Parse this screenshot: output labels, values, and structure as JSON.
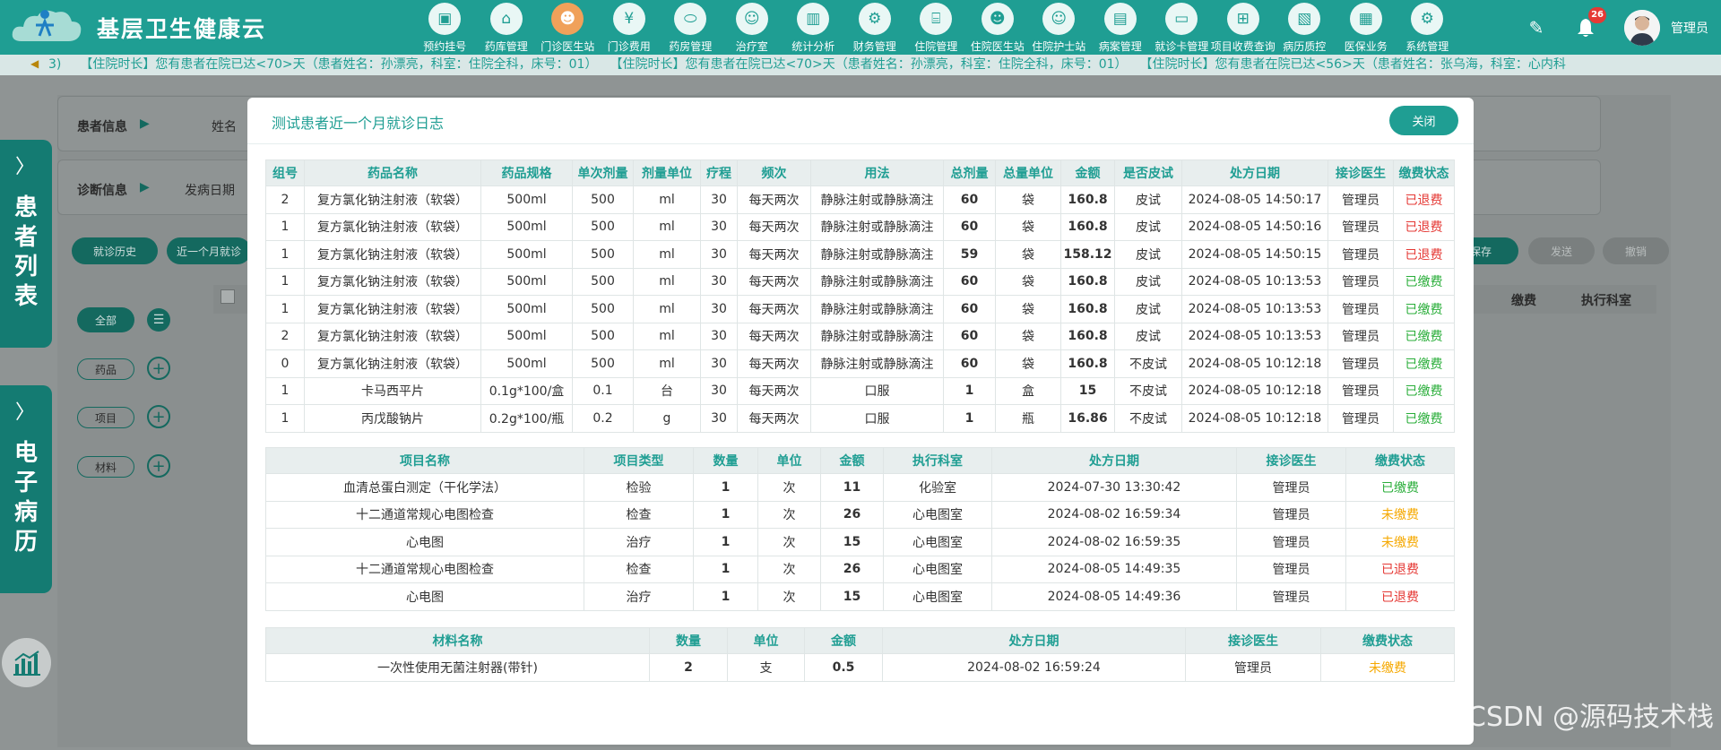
{
  "app": {
    "brand": "基层卫生健康云",
    "username": "管理员",
    "notification_count": "26"
  },
  "nav": [
    {
      "label": "预约挂号",
      "icon": "calendar-icon",
      "glyph": "▣"
    },
    {
      "label": "药库管理",
      "icon": "warehouse-icon",
      "glyph": "⌂"
    },
    {
      "label": "门诊医生站",
      "icon": "doctor-icon",
      "glyph": "☻",
      "active": true
    },
    {
      "label": "门诊费用",
      "icon": "yen-icon",
      "glyph": "¥"
    },
    {
      "label": "药房管理",
      "icon": "pill-icon",
      "glyph": "⬭"
    },
    {
      "label": "治疗室",
      "icon": "nurse-icon",
      "glyph": "☺"
    },
    {
      "label": "统计分析",
      "icon": "chart-icon",
      "glyph": "▥"
    },
    {
      "label": "财务管理",
      "icon": "finance-gear-icon",
      "glyph": "⚙"
    },
    {
      "label": "住院管理",
      "icon": "bed-icon",
      "glyph": "⌸"
    },
    {
      "label": "住院医生站",
      "icon": "inpatient-doctor-icon",
      "glyph": "☻"
    },
    {
      "label": "住院护士站",
      "icon": "inpatient-nurse-icon",
      "glyph": "☺"
    },
    {
      "label": "病案管理",
      "icon": "case-file-icon",
      "glyph": "▤"
    },
    {
      "label": "就诊卡管理",
      "icon": "card-icon",
      "glyph": "▭"
    },
    {
      "label": "项目收费查询",
      "icon": "fee-query-icon",
      "glyph": "⊞"
    },
    {
      "label": "病历质控",
      "icon": "quality-icon",
      "glyph": "▧"
    },
    {
      "label": "医保业务",
      "icon": "insurance-icon",
      "glyph": "▦"
    },
    {
      "label": "系统管理",
      "icon": "system-gear-icon",
      "glyph": "⚙"
    }
  ],
  "marquee": "3)　　【住院时长】您有患者在院已达<70>天（患者姓名：孙漂亮，科室：住院全科，床号：01）　　【住院时长】您有患者在院已达<70>天（患者姓名：孙漂亮，科室：住院全科，床号：01）　　【住院时长】您有患者在院已达<56>天（患者姓名：张乌海，科室：心内科",
  "background": {
    "left_panel_1": "患者列表",
    "left_panel_2": "电子病历",
    "patient_info_label": "患者信息",
    "patient_name_label": "姓名",
    "diagnosis_label": "诊断信息",
    "onset_date_label": "发病日期",
    "history_btn": "就诊历史",
    "recent_btn": "近一个月就诊",
    "save_btn": "保存",
    "send_btn": "发送",
    "revoke_btn": "撤销",
    "col_fee": "缴费",
    "col_dept": "执行科室",
    "filter_all": "全部",
    "filter_drug": "药品",
    "filter_item": "项目",
    "filter_material": "材料"
  },
  "modal": {
    "title": "测试患者近一个月就诊日志",
    "close_label": "关闭",
    "drug_headers": [
      "组号",
      "药品名称",
      "药品规格",
      "单次剂量",
      "剂量单位",
      "疗程",
      "频次",
      "用法",
      "总剂量",
      "总量单位",
      "金额",
      "是否皮试",
      "处方日期",
      "接诊医生",
      "缴费状态"
    ],
    "drugs": [
      [
        "2",
        "复方氯化钠注射液（软袋）",
        "500ml",
        "500",
        "ml",
        "30",
        "每天两次",
        "静脉注射或静脉滴注",
        "60",
        "袋",
        "160.8",
        "皮试",
        "2024-08-05 14:50:17",
        "管理员",
        "已退费"
      ],
      [
        "1",
        "复方氯化钠注射液（软袋）",
        "500ml",
        "500",
        "ml",
        "30",
        "每天两次",
        "静脉注射或静脉滴注",
        "60",
        "袋",
        "160.8",
        "皮试",
        "2024-08-05 14:50:16",
        "管理员",
        "已退费"
      ],
      [
        "1",
        "复方氯化钠注射液（软袋）",
        "500ml",
        "500",
        "ml",
        "30",
        "每天两次",
        "静脉注射或静脉滴注",
        "59",
        "袋",
        "158.12",
        "皮试",
        "2024-08-05 14:50:15",
        "管理员",
        "已退费"
      ],
      [
        "1",
        "复方氯化钠注射液（软袋）",
        "500ml",
        "500",
        "ml",
        "30",
        "每天两次",
        "静脉注射或静脉滴注",
        "60",
        "袋",
        "160.8",
        "皮试",
        "2024-08-05 10:13:53",
        "管理员",
        "已缴费"
      ],
      [
        "1",
        "复方氯化钠注射液（软袋）",
        "500ml",
        "500",
        "ml",
        "30",
        "每天两次",
        "静脉注射或静脉滴注",
        "60",
        "袋",
        "160.8",
        "皮试",
        "2024-08-05 10:13:53",
        "管理员",
        "已缴费"
      ],
      [
        "2",
        "复方氯化钠注射液（软袋）",
        "500ml",
        "500",
        "ml",
        "30",
        "每天两次",
        "静脉注射或静脉滴注",
        "60",
        "袋",
        "160.8",
        "皮试",
        "2024-08-05 10:13:53",
        "管理员",
        "已缴费"
      ],
      [
        "0",
        "复方氯化钠注射液（软袋）",
        "500ml",
        "500",
        "ml",
        "30",
        "每天两次",
        "静脉注射或静脉滴注",
        "60",
        "袋",
        "160.8",
        "不皮试",
        "2024-08-05 10:12:18",
        "管理员",
        "已缴费"
      ],
      [
        "1",
        "卡马西平片",
        "0.1g*100/盒",
        "0.1",
        "台",
        "30",
        "每天两次",
        "口服",
        "1",
        "盒",
        "15",
        "不皮试",
        "2024-08-05 10:12:18",
        "管理员",
        "已缴费"
      ],
      [
        "1",
        "丙戊酸钠片",
        "0.2g*100/瓶",
        "0.2",
        "g",
        "30",
        "每天两次",
        "口服",
        "1",
        "瓶",
        "16.86",
        "不皮试",
        "2024-08-05 10:12:18",
        "管理员",
        "已缴费"
      ]
    ],
    "item_headers": [
      "项目名称",
      "项目类型",
      "数量",
      "单位",
      "金额",
      "执行科室",
      "处方日期",
      "接诊医生",
      "缴费状态"
    ],
    "items": [
      [
        "血清总蛋白测定（干化学法）",
        "检验",
        "1",
        "次",
        "11",
        "化验室",
        "2024-07-30 13:30:42",
        "管理员",
        "已缴费"
      ],
      [
        "十二通道常规心电图检查",
        "检查",
        "1",
        "次",
        "26",
        "心电图室",
        "2024-08-02 16:59:34",
        "管理员",
        "未缴费"
      ],
      [
        "心电图",
        "治疗",
        "1",
        "次",
        "15",
        "心电图室",
        "2024-08-02 16:59:35",
        "管理员",
        "未缴费"
      ],
      [
        "十二通道常规心电图检查",
        "检查",
        "1",
        "次",
        "26",
        "心电图室",
        "2024-08-05 14:49:35",
        "管理员",
        "已退费"
      ],
      [
        "心电图",
        "治疗",
        "1",
        "次",
        "15",
        "心电图室",
        "2024-08-05 14:49:36",
        "管理员",
        "已退费"
      ]
    ],
    "material_headers": [
      "材料名称",
      "数量",
      "单位",
      "金额",
      "处方日期",
      "接诊医生",
      "缴费状态"
    ],
    "materials": [
      [
        "一次性使用无菌注射器(带针)",
        "2",
        "支",
        "0.5",
        "2024-08-02 16:59:24",
        "管理员",
        "未缴费"
      ]
    ]
  },
  "status_colors": {
    "已退费": "#e53935",
    "已缴费": "#2aae3a",
    "未缴费": "#f5a800"
  },
  "watermark": "CSDN @源码技术栈"
}
